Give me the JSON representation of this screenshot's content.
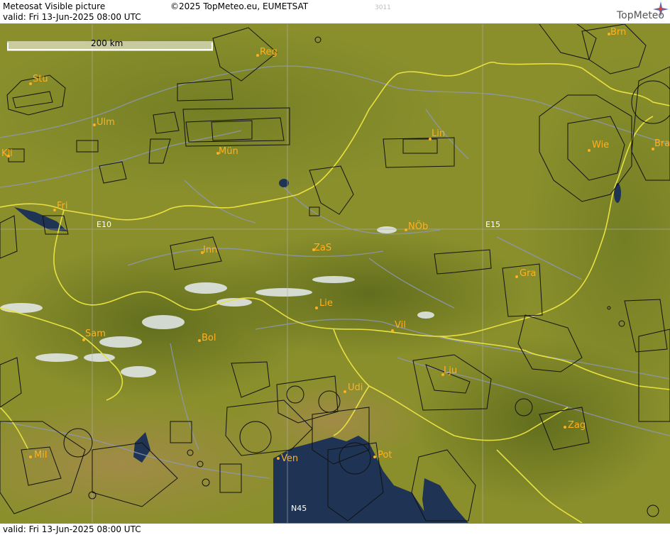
{
  "header": {
    "title": "Meteosat Visible picture",
    "valid": "valid:  Fri  13-Jun-2025  08:00 UTC",
    "copyright": "©2025 TopMeteo.eu, EUMETSAT",
    "code": "3011",
    "brand": "TopMeteo"
  },
  "footer": {
    "valid": "valid:  Fri  13-Jun-2025  08:00 UTC"
  },
  "map": {
    "scale_label": "200 km",
    "grid_labels": {
      "e10": "E10",
      "e15": "E15",
      "n45": "N45"
    },
    "colors": {
      "land": "#8a8f2c",
      "sea": "#1f3454",
      "border": "#e8e040",
      "river": "#8d98b8",
      "airspace": "#111111",
      "city": "#ffb020"
    },
    "cities": [
      {
        "label": "Stu"
      },
      {
        "label": "Reg"
      },
      {
        "label": "Brn"
      },
      {
        "label": "Ulm"
      },
      {
        "label": "Kli"
      },
      {
        "label": "Mün"
      },
      {
        "label": "Lin"
      },
      {
        "label": "Wie"
      },
      {
        "label": "Bra"
      },
      {
        "label": "Fri"
      },
      {
        "label": "NÖb"
      },
      {
        "label": "Inn"
      },
      {
        "label": "ZaS"
      },
      {
        "label": "Gra"
      },
      {
        "label": "Lie"
      },
      {
        "label": "Vil"
      },
      {
        "label": "Sam"
      },
      {
        "label": "Bol"
      },
      {
        "label": "Lju"
      },
      {
        "label": "Udi"
      },
      {
        "label": "Zag"
      },
      {
        "label": "Mil"
      },
      {
        "label": "Ven"
      },
      {
        "label": "Pot"
      }
    ]
  }
}
